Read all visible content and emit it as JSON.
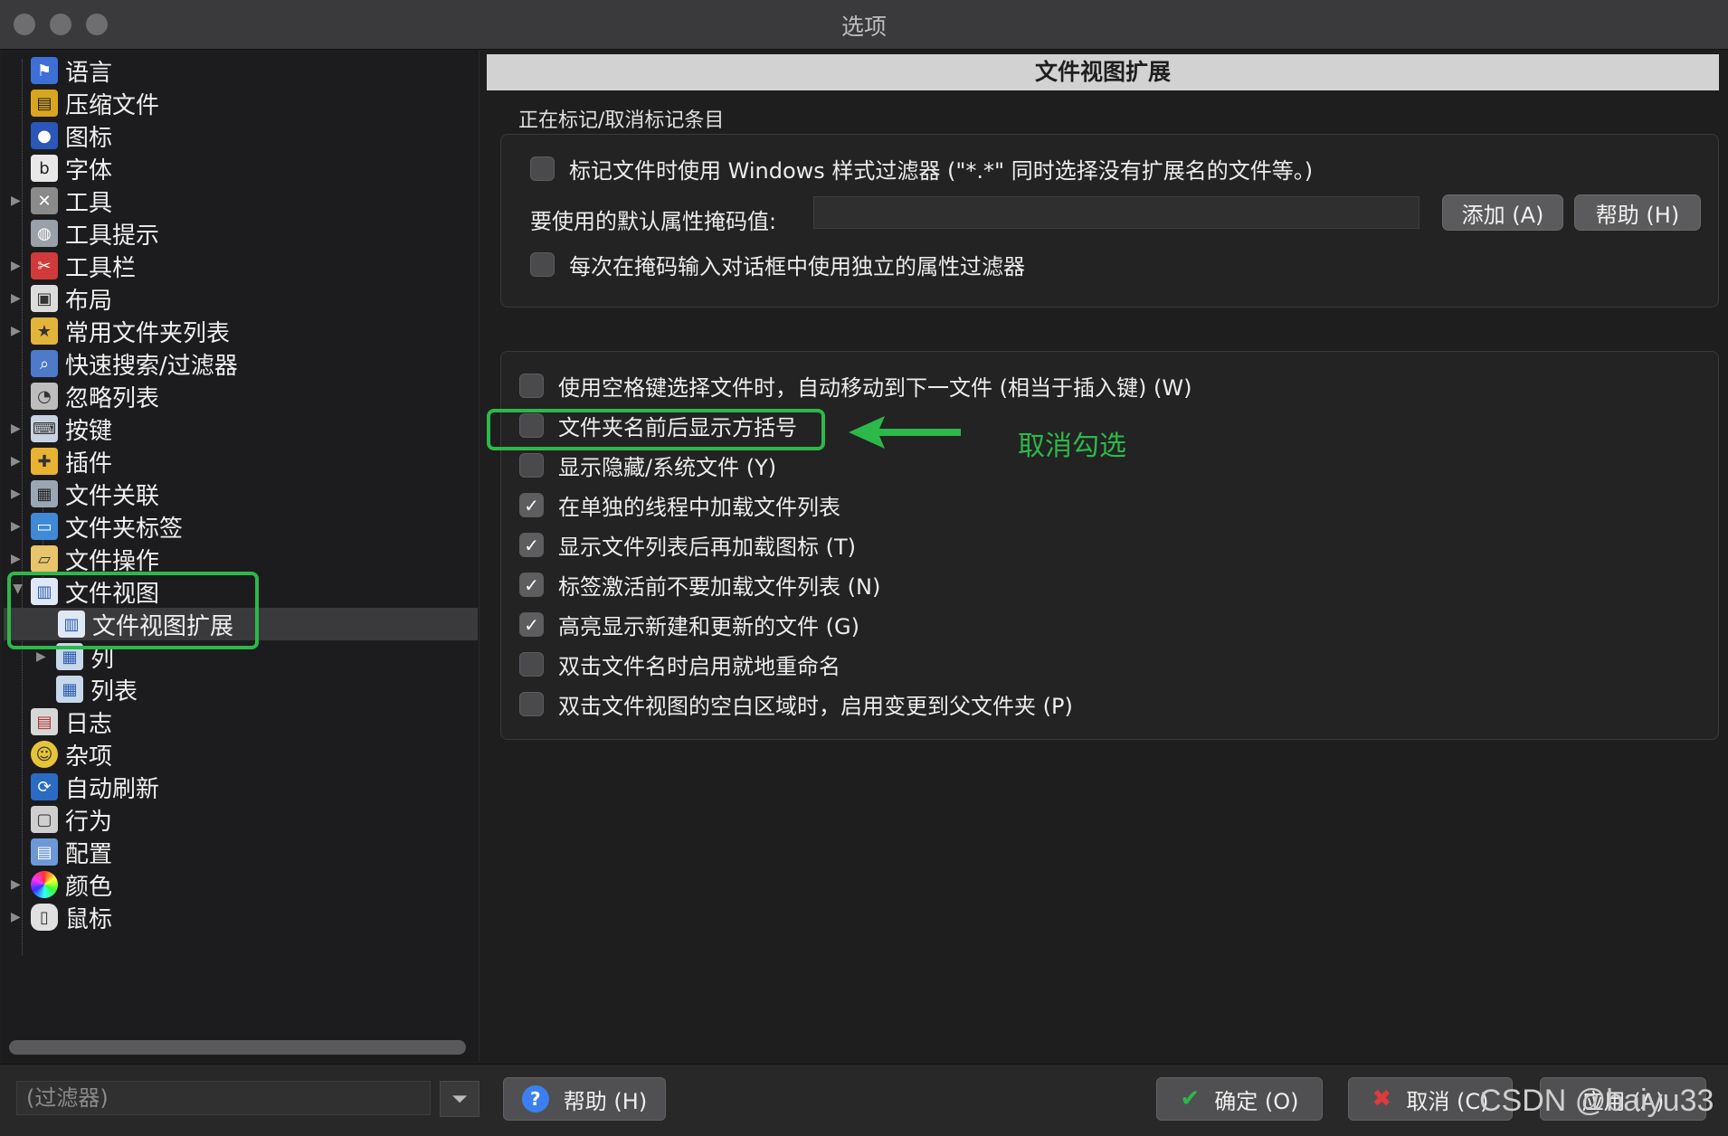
{
  "window": {
    "title": "选项"
  },
  "tree": {
    "items": [
      {
        "label": "语言",
        "icon": "flag-icon"
      },
      {
        "label": "压缩文件",
        "icon": "archive-icon"
      },
      {
        "label": "图标",
        "icon": "icons-icon"
      },
      {
        "label": "字体",
        "icon": "font-icon"
      },
      {
        "label": "工具",
        "icon": "tools-icon"
      },
      {
        "label": "工具提示",
        "icon": "lightbulb-icon"
      },
      {
        "label": "工具栏",
        "icon": "scissors-icon"
      },
      {
        "label": "布局",
        "icon": "layout-icon"
      },
      {
        "label": "常用文件夹列表",
        "icon": "favorites-folder-icon"
      },
      {
        "label": "快速搜索/过滤器",
        "icon": "quick-search-icon"
      },
      {
        "label": "忽略列表",
        "icon": "ignore-list-icon"
      },
      {
        "label": "按键",
        "icon": "keyboard-icon"
      },
      {
        "label": "插件",
        "icon": "plugin-icon"
      },
      {
        "label": "文件关联",
        "icon": "file-association-icon"
      },
      {
        "label": "文件夹标签",
        "icon": "folder-tab-icon"
      },
      {
        "label": "文件操作",
        "icon": "file-operation-icon"
      },
      {
        "label": "文件视图",
        "icon": "file-view-icon"
      },
      {
        "label": "文件视图扩展",
        "icon": "file-view-ext-icon"
      },
      {
        "label": "列",
        "icon": "columns-icon"
      },
      {
        "label": "列表",
        "icon": "list-icon"
      },
      {
        "label": "日志",
        "icon": "log-icon"
      },
      {
        "label": "杂项",
        "icon": "misc-icon"
      },
      {
        "label": "自动刷新",
        "icon": "refresh-icon"
      },
      {
        "label": "行为",
        "icon": "behavior-icon"
      },
      {
        "label": "配置",
        "icon": "config-icon"
      },
      {
        "label": "颜色",
        "icon": "color-wheel-icon"
      },
      {
        "label": "鼠标",
        "icon": "mouse-icon"
      }
    ]
  },
  "panel": {
    "header": "文件视图扩展",
    "section_label": "正在标记/取消标记条目",
    "group1": {
      "cb_windows_filter": "标记文件时使用 Windows 样式过滤器 (\"*.*\" 同时选择没有扩展名的文件等。)",
      "mask_label": "要使用的默认属性掩码值:",
      "mask_value": "",
      "add_button": "添加 (A)",
      "help_button": "帮助 (H)",
      "cb_independent_filter": "每次在掩码输入对话框中使用独立的属性过滤器"
    },
    "group2": [
      {
        "label": "使用空格键选择文件时，自动移动到下一文件 (相当于插入键) (W)",
        "checked": false
      },
      {
        "label": "文件夹名前后显示方括号",
        "checked": false
      },
      {
        "label": "显示隐藏/系统文件 (Y)",
        "checked": false
      },
      {
        "label": "在单独的线程中加载文件列表",
        "checked": true
      },
      {
        "label": "显示文件列表后再加载图标 (T)",
        "checked": true
      },
      {
        "label": "标签激活前不要加载文件列表 (N)",
        "checked": true
      },
      {
        "label": "高亮显示新建和更新的文件 (G)",
        "checked": true
      },
      {
        "label": "双击文件名时启用就地重命名",
        "checked": false
      },
      {
        "label": "双击文件视图的空白区域时，启用变更到父文件夹 (P)",
        "checked": false
      }
    ],
    "annotation": "取消勾选"
  },
  "bottom": {
    "filter_placeholder": "(过滤器)",
    "help": "帮助 (H)",
    "ok": "确定 (O)",
    "cancel": "取消 (C)",
    "apply": "应用 (A)"
  },
  "watermark": "CSDN @baiyu33",
  "colors": {
    "highlight": "#2db84a",
    "help_icon": "#3b7ff0",
    "cancel_x": "#e03a3a",
    "ok_check": "#2db84a"
  }
}
